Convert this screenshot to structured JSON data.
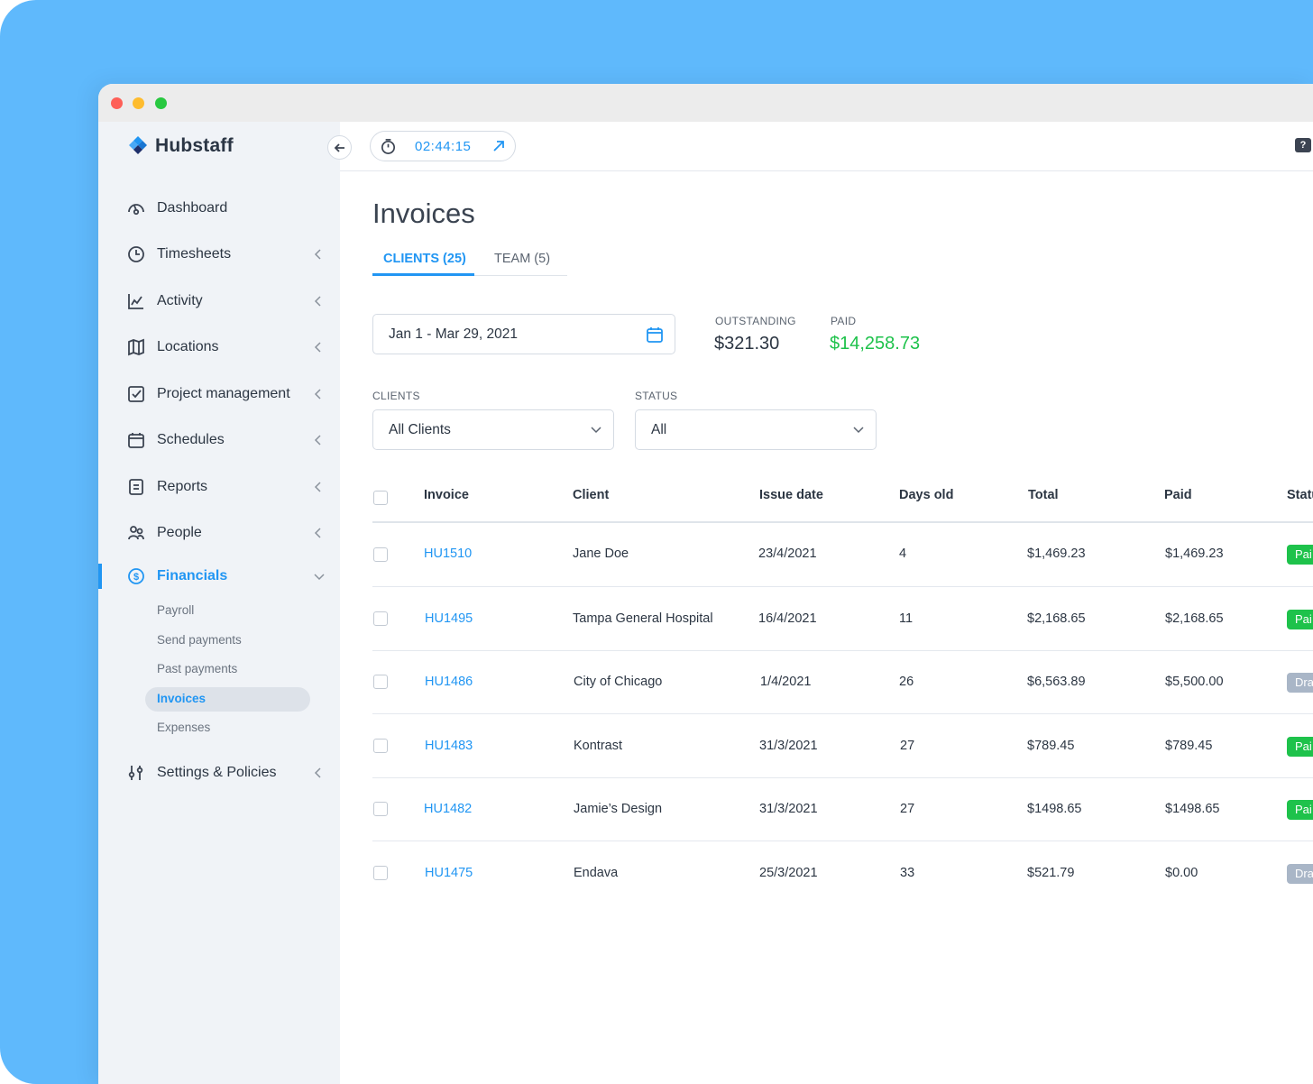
{
  "app": {
    "name": "Hubstaff",
    "timer": "02:44:15"
  },
  "sidebar": {
    "items": [
      {
        "label": "Dashboard",
        "icon": "dashboard-icon"
      },
      {
        "label": "Timesheets",
        "icon": "clock-icon"
      },
      {
        "label": "Activity",
        "icon": "activity-chart-icon"
      },
      {
        "label": "Locations",
        "icon": "map-icon"
      },
      {
        "label": "Project management",
        "icon": "checkbox-icon"
      },
      {
        "label": "Schedules",
        "icon": "calendar-icon"
      },
      {
        "label": "Reports",
        "icon": "report-icon"
      },
      {
        "label": "People",
        "icon": "people-icon"
      },
      {
        "label": "Financials",
        "icon": "dollar-icon"
      },
      {
        "label": "Settings & Policies",
        "icon": "sliders-icon"
      }
    ],
    "financials_sub": [
      "Payroll",
      "Send payments",
      "Past payments",
      "Invoices",
      "Expenses"
    ]
  },
  "page": {
    "title": "Invoices",
    "tabs": [
      "CLIENTS (25)",
      "TEAM (5)"
    ],
    "date_range": "Jan 1 - Mar 29, 2021",
    "outstanding_label": "OUTSTANDING",
    "outstanding_value": "$321.30",
    "paid_label": "PAID",
    "paid_value": "$14,258.73",
    "clients_label": "CLIENTS",
    "clients_value": "All Clients",
    "status_label": "STATUS",
    "status_value": "All"
  },
  "table": {
    "headers": [
      "Invoice",
      "Client",
      "Issue date",
      "Days old",
      "Total",
      "Paid",
      "Statu"
    ],
    "rows": [
      {
        "invoice": "HU1510",
        "client": "Jane Doe",
        "issue_date": "23/4/2021",
        "days_old": "4",
        "total": "$1,469.23",
        "paid": "$1,469.23",
        "status": "Pai"
      },
      {
        "invoice": "HU1495",
        "client": "Tampa General Hospital",
        "issue_date": "16/4/2021",
        "days_old": "11",
        "total": "$2,168.65",
        "paid": "$2,168.65",
        "status": "Pai"
      },
      {
        "invoice": "HU1486",
        "client": "City of Chicago",
        "issue_date": "1/4/2021",
        "days_old": "26",
        "total": "$6,563.89",
        "paid": "$5,500.00",
        "status": "Dra"
      },
      {
        "invoice": "HU1483",
        "client": "Kontrast",
        "issue_date": "31/3/2021",
        "days_old": "27",
        "total": "$789.45",
        "paid": "$789.45",
        "status": "Pai"
      },
      {
        "invoice": "HU1482",
        "client": "Jamie’s Design",
        "issue_date": "31/3/2021",
        "days_old": "27",
        "total": "$1498.65",
        "paid": "$1498.65",
        "status": "Pai"
      },
      {
        "invoice": "HU1475",
        "client": "Endava",
        "issue_date": "25/3/2021",
        "days_old": "33",
        "total": "$521.79",
        "paid": "$0.00",
        "status": "Dra"
      }
    ]
  },
  "colors": {
    "accent": "#2196f3",
    "paid_green": "#1ec24b",
    "paid_value_green": "#1ec24b",
    "draft_gray": "#a9b6c7",
    "background_blue": "#5fb9fc"
  }
}
